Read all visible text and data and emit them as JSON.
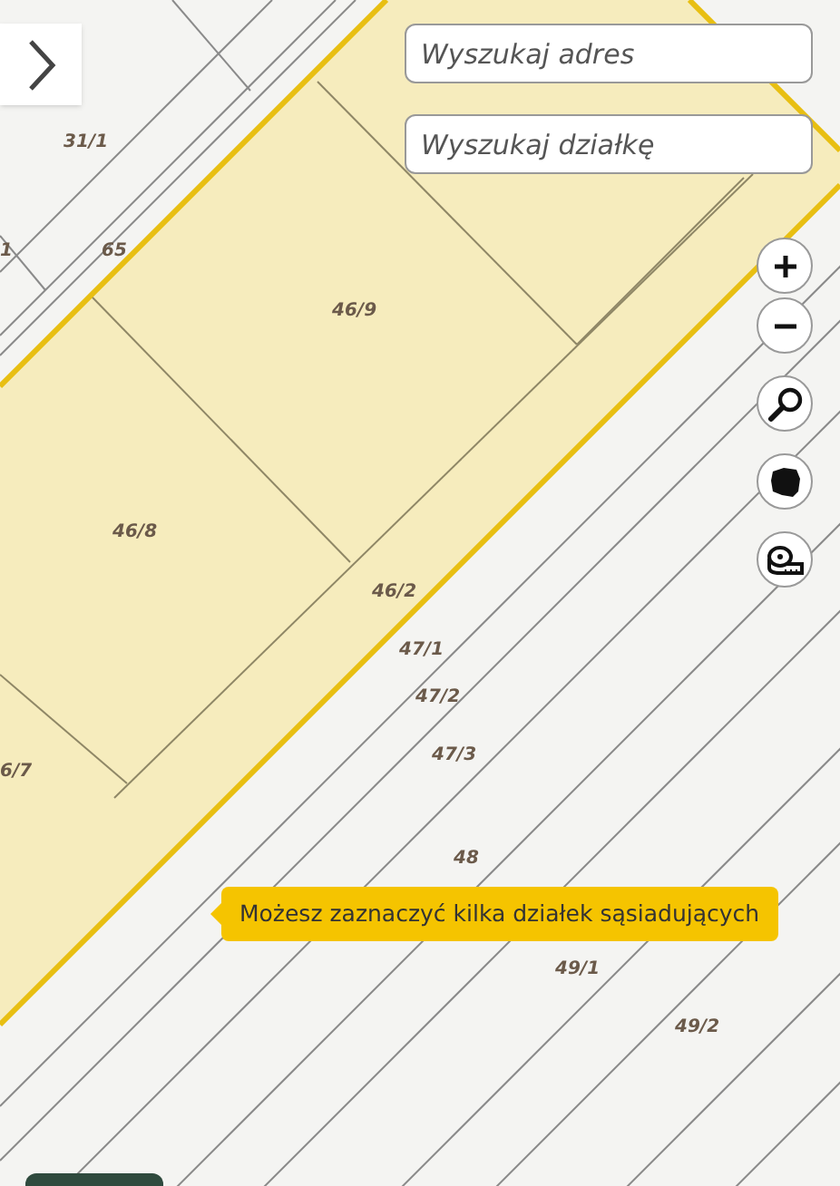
{
  "search_fields": [
    {
      "placeholder": "Wyszukaj adres"
    },
    {
      "placeholder": "Wyszukaj działkę"
    }
  ],
  "map": {
    "parcel_labels": [
      "31/1",
      "65",
      "1",
      "46/9",
      "46/8",
      "46/2",
      "47/1",
      "47/2",
      "47/3",
      "6/7",
      "48",
      "49/1",
      "49/2"
    ]
  },
  "hint": "Możesz zaznaczyć kilka działek sąsiadujących"
}
